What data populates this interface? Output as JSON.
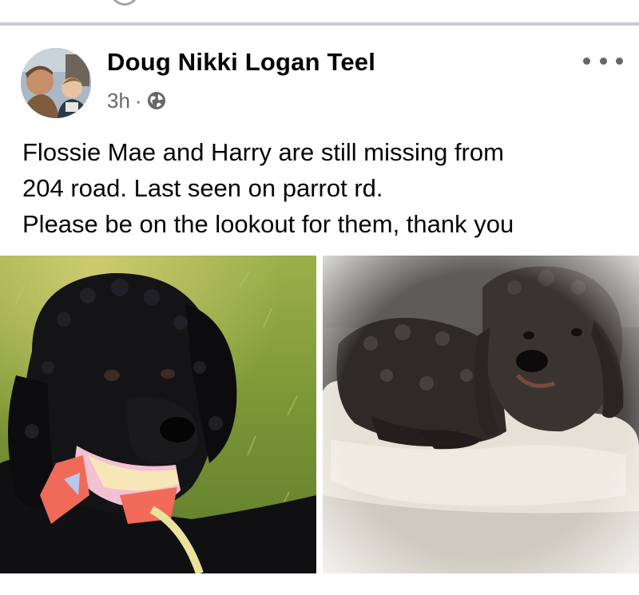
{
  "post": {
    "author": "Doug Nikki Logan Teel",
    "timestamp": "3h",
    "separator": "·",
    "privacy_icon": "globe-icon",
    "more_icon": "more-options-icon",
    "text_lines": [
      "Flossie Mae and Harry are still missing from",
      "204 road.  Last seen on parrot rd.",
      "Please be on the lookout for them, thank you"
    ],
    "photos": [
      {
        "subject": "black-poodle-with-bandana"
      },
      {
        "subject": "dark-doodle-on-dog-bed"
      }
    ]
  },
  "colors": {
    "divider": "#c9ccd1",
    "secondary_text": "#65676b",
    "primary_text": "#050505"
  }
}
